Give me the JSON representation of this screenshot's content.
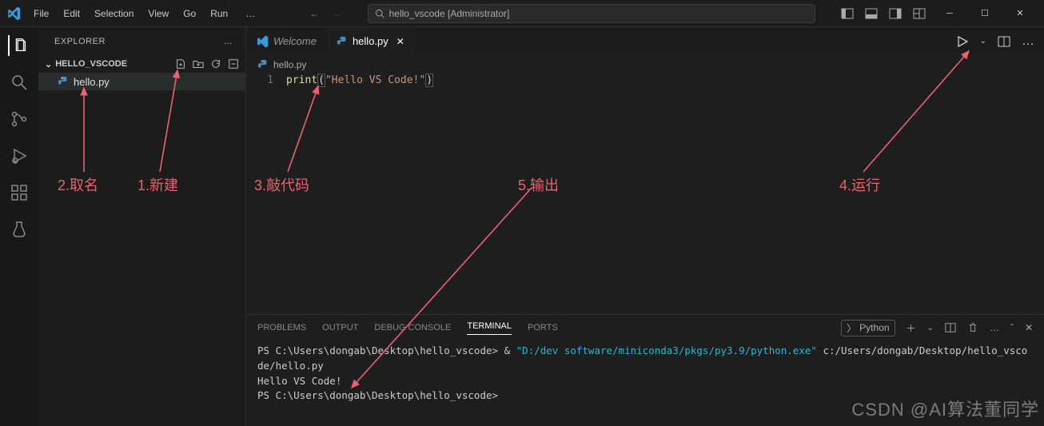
{
  "titlebar": {
    "menu": [
      "File",
      "Edit",
      "Selection",
      "View",
      "Go",
      "Run"
    ],
    "dots": "…",
    "search_text": "hello_vscode [Administrator]"
  },
  "sidebar": {
    "header": "EXPLORER",
    "folder": "HELLO_VSCODE",
    "file": "hello.py"
  },
  "tabs": {
    "welcome": "Welcome",
    "file": "hello.py"
  },
  "breadcrumb": "hello.py",
  "code": {
    "line_no": "1",
    "fn": "print",
    "open": "(",
    "str": "\"Hello VS Code!\"",
    "close": ")"
  },
  "panel": {
    "tabs": [
      "PROBLEMS",
      "OUTPUT",
      "DEBUG CONSOLE",
      "TERMINAL",
      "PORTS"
    ],
    "launch_label": "Python",
    "prompt1": "PS C:\\Users\\dongab\\Desktop\\hello_vscode> ",
    "amp": "& ",
    "py_path": "\"D:/dev software/miniconda3/pkgs/py3.9/python.exe\"",
    "script_path": " c:/Users/dongab/Desktop/hello_vscode/hello.py",
    "output": "Hello VS Code!",
    "prompt2": "PS C:\\Users\\dongab\\Desktop\\hello_vscode>"
  },
  "annotations": {
    "a1": "1.新建",
    "a2": "2.取名",
    "a3": "3.敲代码",
    "a4": "4.运行",
    "a5": "5.输出"
  },
  "watermark": "CSDN @AI算法董同学"
}
